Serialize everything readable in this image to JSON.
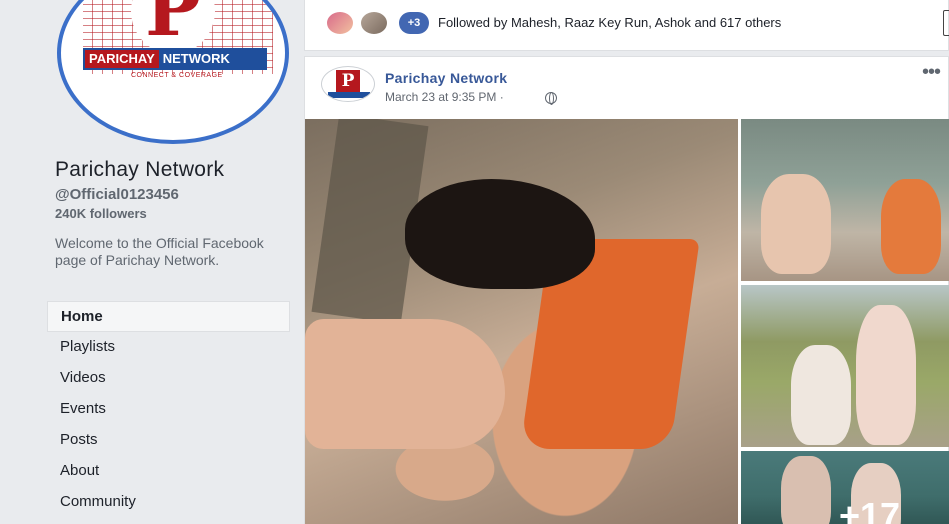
{
  "page": {
    "name": "Parichay Network",
    "handle": "@Official0123456",
    "followers": "240K followers",
    "about": "Welcome to the Official Facebook page of Parichay Network."
  },
  "logo": {
    "letter": "P",
    "banner_left": "PARICHAY",
    "banner_right": "NETWORK",
    "tagline": "CONNECT & COVERAGE"
  },
  "nav": [
    {
      "label": "Home",
      "active": true
    },
    {
      "label": "Playlists"
    },
    {
      "label": "Videos"
    },
    {
      "label": "Events"
    },
    {
      "label": "Posts"
    },
    {
      "label": "About"
    },
    {
      "label": "Community"
    }
  ],
  "followed": {
    "plus_count": "+3",
    "text": "Followed by Mahesh, Raaz Key Run, Ashok and 617 others"
  },
  "post": {
    "author": "Parichay Network",
    "time": "March 23 at 9:35 PM ·",
    "more_icon": "more-icon",
    "avatar_letter": "P",
    "extra_photos": "+17"
  },
  "colors": {
    "fb_blue": "#4267b2",
    "link_blue": "#385898",
    "logo_red": "#b5181e",
    "ring_blue": "#3b6fc9",
    "page_bg": "#e9ebee"
  }
}
